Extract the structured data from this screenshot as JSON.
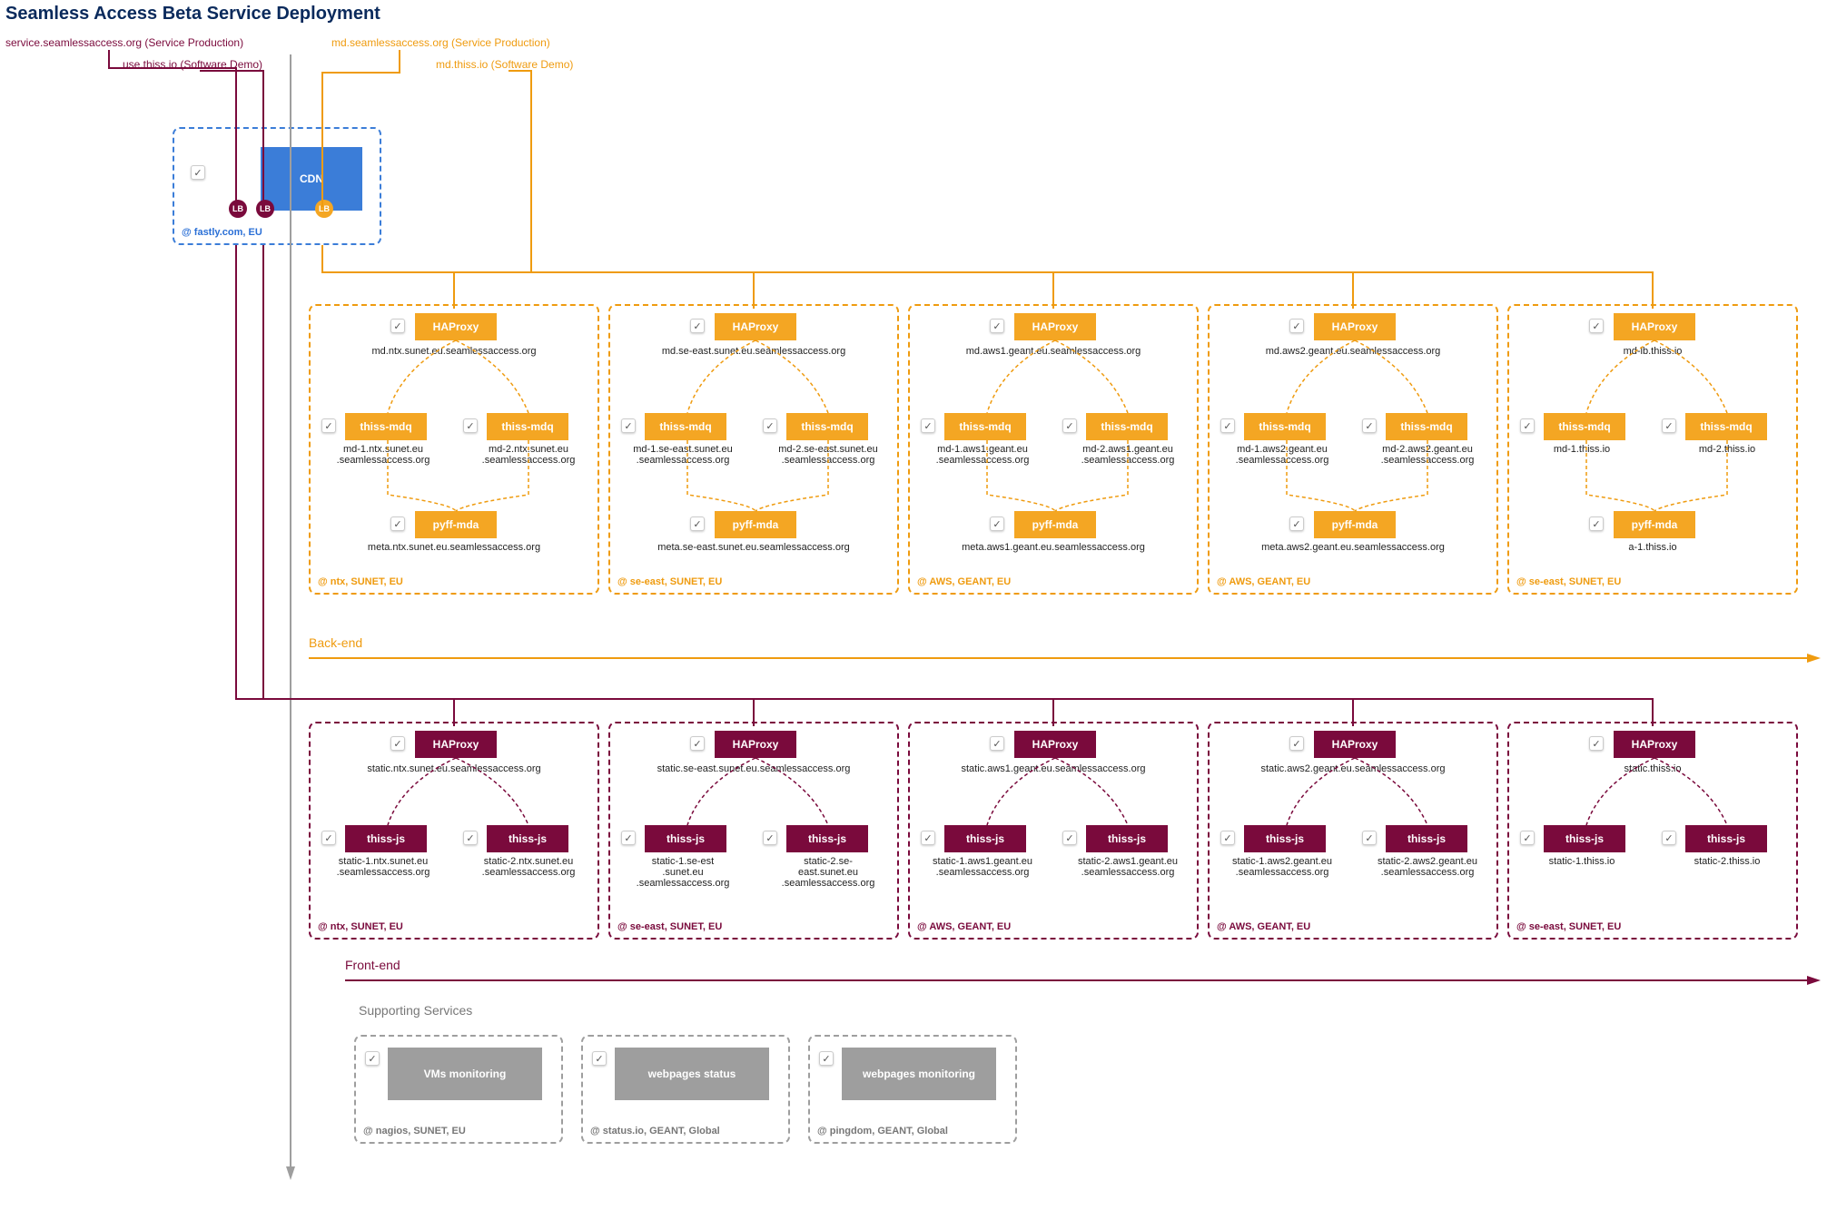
{
  "title": "Seamless Access Beta Service Deployment",
  "entrypoints": {
    "service_prod_fe": "service.seamlessaccess.org (Service Production)",
    "software_demo_fe": "use.thiss.io (Software Demo)",
    "service_prod_md": "md.seamlessaccess.org (Service Production)",
    "software_demo_md": "md.thiss.io (Software Demo)"
  },
  "cdn": {
    "label": "CDN",
    "lb": "LB",
    "location": "@ fastly.com, EU"
  },
  "sections": {
    "backend": "Back-end",
    "frontend": "Front-end",
    "supporting": "Supporting Services"
  },
  "svc": {
    "haproxy": "HAProxy",
    "thiss_mdq": "thiss-mdq",
    "pyff_mda": "pyff-mda",
    "thiss_js": "thiss-js",
    "vm_mon": "VMs monitoring",
    "web_status": "webpages status",
    "web_mon": "webpages monitoring"
  },
  "locations": {
    "ntx": "@ ntx, SUNET, EU",
    "seeast": "@ se-east, SUNET, EU",
    "aws": "@ AWS, GEANT, EU",
    "nagios": "@ nagios, SUNET, EU",
    "statusio": "@ status.io, GEANT, Global",
    "pingdom": "@ pingdom, GEANT, Global"
  },
  "backend": [
    {
      "haproxy": "md.ntx.sunet.eu.seamlessaccess.org",
      "mdq1": "md-1.ntx.sunet.eu\n.seamlessaccess.org",
      "mdq2": "md-2.ntx.sunet.eu\n.seamlessaccess.org",
      "pyff": "meta.ntx.sunet.eu.seamlessaccess.org",
      "loc": "ntx"
    },
    {
      "haproxy": "md.se-east.sunet.eu.seamlessaccess.org",
      "mdq1": "md-1.se-east.sunet.eu\n.seamlessaccess.org",
      "mdq2": "md-2.se-east.sunet.eu\n.seamlessaccess.org",
      "pyff": "meta.se-east.sunet.eu.seamlessaccess.org",
      "loc": "seeast"
    },
    {
      "haproxy": "md.aws1.geant.eu.seamlessaccess.org",
      "mdq1": "md-1.aws1.geant.eu\n.seamlessaccess.org",
      "mdq2": "md-2.aws1.geant.eu\n.seamlessaccess.org",
      "pyff": "meta.aws1.geant.eu.seamlessaccess.org",
      "loc": "aws"
    },
    {
      "haproxy": "md.aws2.geant.eu.seamlessaccess.org",
      "mdq1": "md-1.aws2.geant.eu\n.seamlessaccess.org",
      "mdq2": "md-2.aws2.geant.eu\n.seamlessaccess.org",
      "pyff": "meta.aws2.geant.eu.seamlessaccess.org",
      "loc": "aws"
    },
    {
      "haproxy": "md-lb.thiss.io",
      "mdq1": "md-1.thiss.io",
      "mdq2": "md-2.thiss.io",
      "pyff": "a-1.thiss.io",
      "loc": "seeast"
    }
  ],
  "frontend": [
    {
      "haproxy": "static.ntx.sunet.eu.seamlessaccess.org",
      "js1": "static-1.ntx.sunet.eu\n.seamlessaccess.org",
      "js2": "static-2.ntx.sunet.eu\n.seamlessaccess.org",
      "loc": "ntx"
    },
    {
      "haproxy": "static.se-east.sunet.eu.seamlessaccess.org",
      "js1": "static-1.se-est\n.sunet.eu\n.seamlessaccess.org",
      "js2": "static-2.se-\neast.sunet.eu\n.seamlessaccess.org",
      "loc": "seeast"
    },
    {
      "haproxy": "static.aws1.geant.eu.seamlessaccess.org",
      "js1": "static-1.aws1.geant.eu\n.seamlessaccess.org",
      "js2": "static-2.aws1.geant.eu\n.seamlessaccess.org",
      "loc": "aws"
    },
    {
      "haproxy": "static.aws2.geant.eu.seamlessaccess.org",
      "js1": "static-1.aws2.geant.eu\n.seamlessaccess.org",
      "js2": "static-2.aws2.geant.eu\n.seamlessaccess.org",
      "loc": "aws"
    },
    {
      "haproxy": "static.thiss.io",
      "js1": "static-1.thiss.io",
      "js2": "static-2.thiss.io",
      "loc": "seeast"
    }
  ]
}
